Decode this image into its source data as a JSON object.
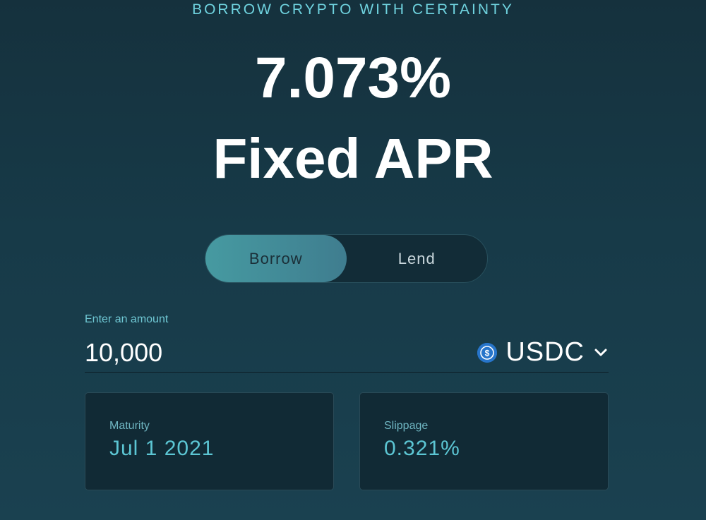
{
  "header": {
    "tagline": "BORROW CRYPTO WITH CERTAINTY",
    "rate": "7.073%",
    "rate_label": "Fixed APR"
  },
  "mode_toggle": {
    "options": [
      {
        "label": "Borrow",
        "active": true
      },
      {
        "label": "Lend",
        "active": false
      }
    ]
  },
  "amount": {
    "label": "Enter an amount",
    "value": "10,000",
    "placeholder": "0"
  },
  "currency": {
    "code": "USDC",
    "icon": "usdc-coin-icon",
    "icon_color": "#2775ca"
  },
  "details": {
    "maturity": {
      "label": "Maturity",
      "value": "Jul 1 2021"
    },
    "slippage": {
      "label": "Slippage",
      "value": "0.321%"
    }
  },
  "colors": {
    "accent": "#6fd3df",
    "toggle_active": "#469aa1",
    "card_value": "#5cc6d4"
  }
}
